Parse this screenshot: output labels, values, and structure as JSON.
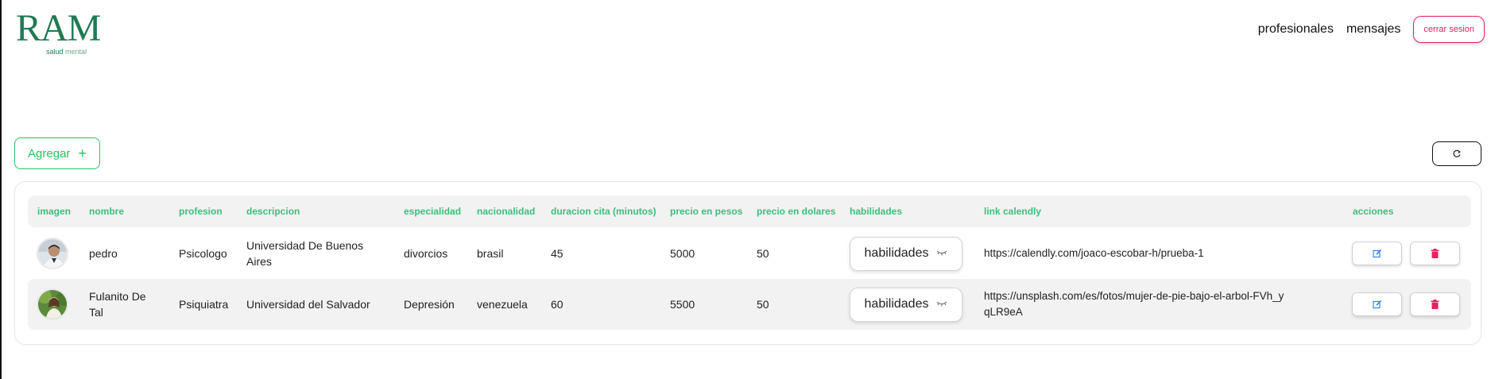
{
  "brand": {
    "name": "RAM",
    "sub_bold": "salud",
    "sub_light": "mental"
  },
  "nav": {
    "profesionales": "profesionales",
    "mensajes": "mensajes",
    "logout": "cerrar sesion"
  },
  "toolbar": {
    "add_label": "Agregar",
    "add_icon": "plus-icon",
    "refresh_icon": "refresh-icon"
  },
  "table": {
    "headers": [
      "imagen",
      "nombre",
      "profesion",
      "descripcion",
      "especialidad",
      "nacionalidad",
      "duracion cita (minutos)",
      "precio en pesos",
      "precio en dolares",
      "habilidades",
      "link calendly",
      "acciones"
    ],
    "rows": [
      {
        "nombre": "pedro",
        "profesion": "Psicologo",
        "descripcion": "Universidad De Buenos Aires",
        "especialidad": "divorcios",
        "nacionalidad": "brasil",
        "duracion": "45",
        "precio_pesos": "5000",
        "precio_dolares": "50",
        "habilidades": "habilidades",
        "link": "https://calendly.com/joaco-escobar-h/prueba-1"
      },
      {
        "nombre": "Fulanito De Tal",
        "profesion": "Psiquiatra",
        "descripcion": "Universidad del Salvador",
        "especialidad": "Depresión",
        "nacionalidad": "venezuela",
        "duracion": "60",
        "precio_pesos": "5500",
        "precio_dolares": "50",
        "habilidades": "habilidades",
        "link": "https://unsplash.com/es/fotos/mujer-de-pie-bajo-el-arbol-FVh_yqLR9eA"
      }
    ]
  },
  "colors": {
    "brand_green": "#1f7a55",
    "accent_green": "#22c55e",
    "header_text": "#3dbf7a",
    "logout_pink": "#e0245e",
    "edit_blue": "#3b82f6",
    "delete_pink": "#e0245e"
  }
}
